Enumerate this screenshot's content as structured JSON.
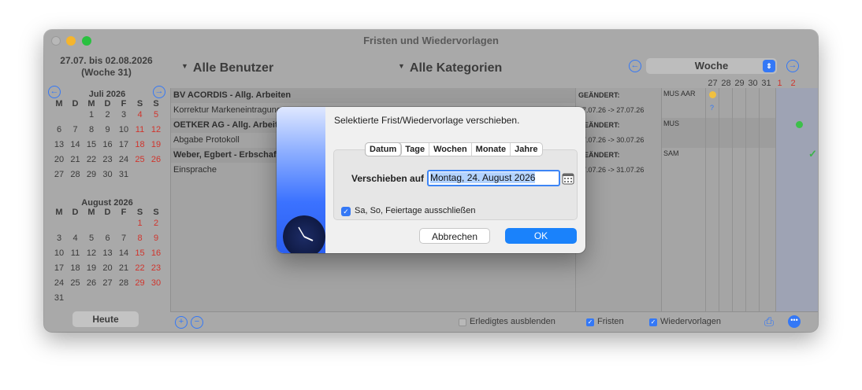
{
  "window": {
    "title": "Fristen und Wiedervorlagen"
  },
  "toolbar": {
    "range_line1": "27.07. bis 02.08.2026",
    "range_line2": "(Woche 31)",
    "users_popup": "Alle Benutzer",
    "categories_popup": "Alle Kategorien",
    "view_select": "Woche",
    "day_numbers": [
      "27",
      "28",
      "29",
      "30",
      "31",
      "1",
      "2"
    ]
  },
  "calendar": {
    "july": {
      "title": "Juli 2026",
      "weekdays": [
        "M",
        "D",
        "M",
        "D",
        "F",
        "S",
        "S"
      ],
      "weeks": [
        [
          "",
          "",
          "1",
          "2",
          "3",
          "4",
          "5"
        ],
        [
          "6",
          "7",
          "8",
          "9",
          "10",
          "11",
          "12"
        ],
        [
          "13",
          "14",
          "15",
          "16",
          "17",
          "18",
          "19"
        ],
        [
          "20",
          "21",
          "22",
          "23",
          "24",
          "25",
          "26"
        ],
        [
          "27",
          "28",
          "29",
          "30",
          "31",
          "",
          ""
        ]
      ]
    },
    "august": {
      "title": "August 2026",
      "weekdays": [
        "M",
        "D",
        "M",
        "D",
        "F",
        "S",
        "S"
      ],
      "weeks": [
        [
          "",
          "",
          "",
          "",
          "",
          "1",
          "2"
        ],
        [
          "3",
          "4",
          "5",
          "6",
          "7",
          "8",
          "9"
        ],
        [
          "10",
          "11",
          "12",
          "13",
          "14",
          "15",
          "16"
        ],
        [
          "17",
          "18",
          "19",
          "20",
          "21",
          "22",
          "23"
        ],
        [
          "24",
          "25",
          "26",
          "27",
          "28",
          "29",
          "30"
        ],
        [
          "31",
          "",
          "",
          "",
          "",
          "",
          ""
        ]
      ]
    },
    "today_button": "Heute"
  },
  "list": {
    "rows": [
      {
        "text": "BV ACORDIS - Allg. Arbeiten",
        "group": true
      },
      {
        "text": "Korrektur Markeneintragung",
        "group": false
      },
      {
        "text": "OETKER AG - Allg. Arbeiten",
        "group": true
      },
      {
        "text": "Abgabe Protokoll",
        "group": false
      },
      {
        "text": "Weber, Egbert - Erbschaft",
        "group": true
      },
      {
        "text": "Einsprache",
        "group": false
      }
    ]
  },
  "status": {
    "rows": [
      {
        "label": "GEÄNDERT:",
        "dates": "27.07.26 -> 27.07.26",
        "user": "MUS AAR"
      },
      {
        "label": "GEÄNDERT:",
        "dates": "27.07.26 -> 30.07.26",
        "user": "MUS"
      },
      {
        "label": "GEÄNDERT:",
        "dates": "27.07.26 -> 31.07.26",
        "user": "SAM"
      }
    ],
    "question_mark": "?"
  },
  "bottombar": {
    "hide_done": "Erledigtes ausblenden",
    "fristen": "Fristen",
    "wiedervorlagen": "Wiedervorlagen"
  },
  "dialog": {
    "message": "Selektierte Frist/Wiedervorlage verschieben.",
    "tabs": [
      "Datum",
      "Tage",
      "Wochen",
      "Monate",
      "Jahre"
    ],
    "move_label": "Verschieben auf",
    "date_value": "Montag, 24. August 2026",
    "exclude_label": "Sa, So, Feiertage ausschließen",
    "cancel": "Abbrechen",
    "ok": "OK"
  },
  "colors": {
    "accent": "#1a82fb",
    "weekend": "#d0352d",
    "today": "#2a8a2a",
    "yellow_dot": "#f0c040",
    "green_dot": "#3cc04a"
  }
}
